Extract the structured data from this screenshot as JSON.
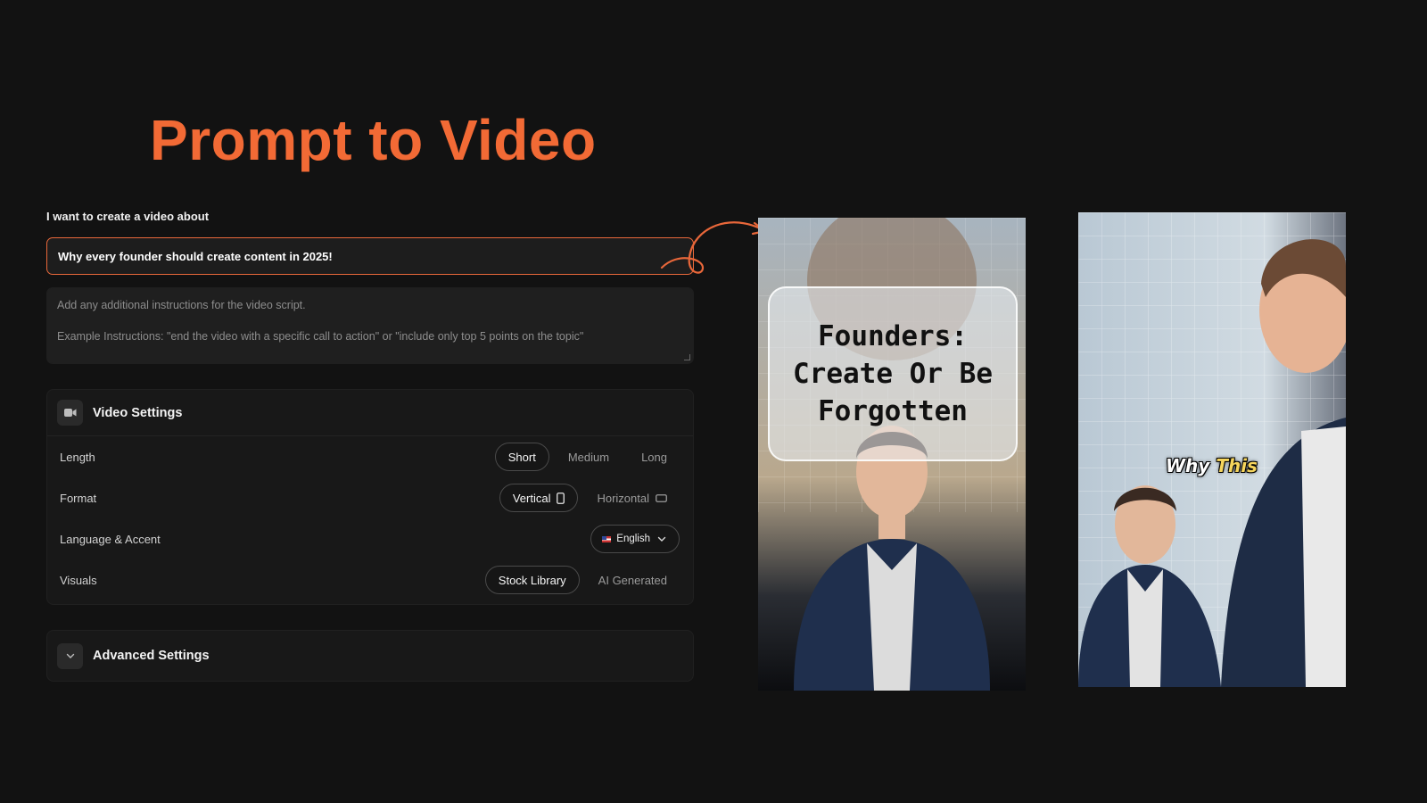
{
  "hero": {
    "title": "Prompt to Video"
  },
  "form": {
    "prompt_label": "I want to create a video about",
    "prompt_value": "Why every founder should create content in 2025!",
    "instructions_line1": "Add any additional instructions for the video script.",
    "instructions_line2": "Example Instructions: \"end the video with a specific call to action\" or \"include only top 5 points on the topic\""
  },
  "video_settings": {
    "title": "Video Settings",
    "length": {
      "label": "Length",
      "options": [
        "Short",
        "Medium",
        "Long"
      ],
      "selected": "Short"
    },
    "format": {
      "label": "Format",
      "options": [
        "Vertical",
        "Horizontal"
      ],
      "selected": "Vertical"
    },
    "language": {
      "label": "Language & Accent",
      "selected": "English"
    },
    "visuals": {
      "label": "Visuals",
      "options": [
        "Stock Library",
        "AI Generated"
      ],
      "selected": "Stock Library"
    }
  },
  "advanced_settings": {
    "title": "Advanced Settings"
  },
  "previews": {
    "card1_title": "Founders: Create Or Be Forgotten",
    "card2_caption_white": "Why",
    "card2_caption_highlight": "This"
  },
  "colors": {
    "accent": "#f26a35",
    "background": "#121212",
    "panel": "#181818"
  },
  "icons": {
    "video_settings": "video-camera-icon",
    "advanced": "chevron-down-icon",
    "vertical": "phone-icon",
    "horizontal": "landscape-icon",
    "language": "chevron-down-icon"
  }
}
